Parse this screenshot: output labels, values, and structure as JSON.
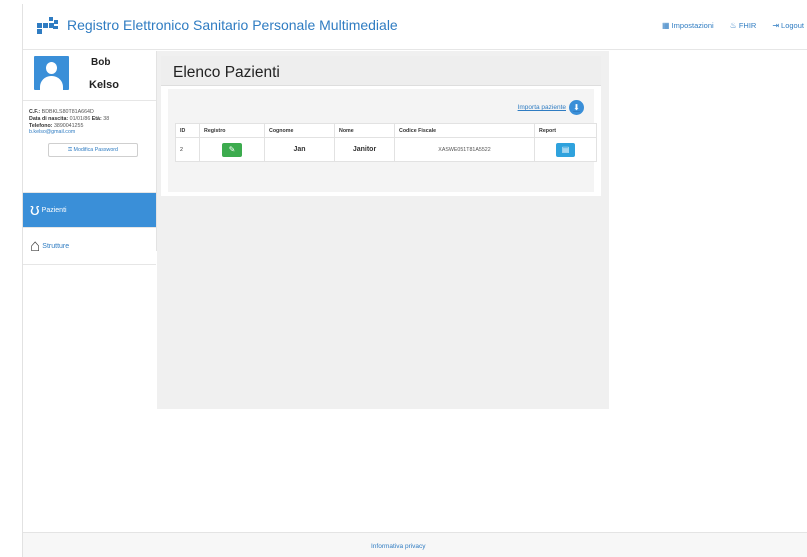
{
  "brand": {
    "title": "Registro Elettronico Sanitario Personale Multimediale"
  },
  "nav": {
    "impostazioni": "Impostazioni",
    "fhir": "FHIR",
    "logout": "Logout"
  },
  "user": {
    "first_name": "Bob",
    "last_name": "Kelso",
    "cf_label": "C.F.:",
    "cf_value": "BDBKLS80T81A664D",
    "birth_label": "Data di nascita:",
    "birth_value": "01/01/86",
    "age_label": "Età:",
    "age_value": "38",
    "phone_label": "Telefono:",
    "phone_value": "3890041255",
    "email": "b.kelso@gmail.com",
    "change_password": "Modifica Password"
  },
  "sidebar": {
    "items": [
      {
        "label": "Pazienti",
        "icon": "stethoscope-icon"
      },
      {
        "label": "Strutture",
        "icon": "home-icon"
      }
    ]
  },
  "main": {
    "title": "Elenco Pazienti",
    "import_label": "Importa paziente",
    "table": {
      "headers": [
        "ID",
        "Registro",
        "Cognome",
        "Nome",
        "Codice Fiscale",
        "Report"
      ],
      "rows": [
        {
          "id": "2",
          "cognome": "Jan",
          "nome": "Janitor",
          "codice_fiscale": "XASWE051T81A5522"
        }
      ]
    }
  },
  "footer": {
    "privacy": "Informativa privacy"
  },
  "colors": {
    "accent": "#2f7cc2",
    "active": "#3a8fd8",
    "green": "#3cab4e",
    "report": "#2fa2dd"
  }
}
